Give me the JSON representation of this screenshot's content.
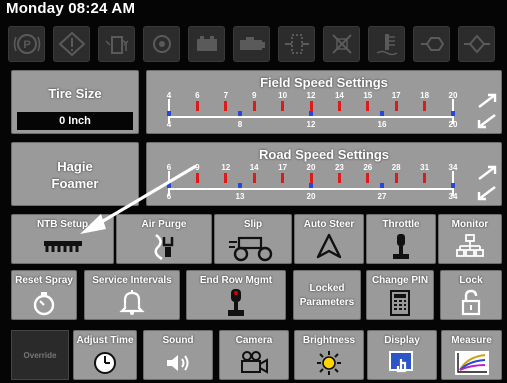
{
  "header": {
    "datetime": "Monday 08:24 AM"
  },
  "alarm_icons": [
    "parking-brake-icon",
    "warning-icon",
    "fuel-level-icon",
    "engine-icon",
    "battery-icon",
    "engine-oil-icon",
    "hydraulic-filter-icon",
    "fuel-filter-icon",
    "coolant-temp-icon",
    "transmission-icon",
    "hydraulic-oil-icon"
  ],
  "tire_size": {
    "label": "Tire Size",
    "value": "0 Inch"
  },
  "product": {
    "line1": "Hagie",
    "line2": "Foamer"
  },
  "field_speed": {
    "title": "Field Speed Settings",
    "top_labels": [
      "4",
      "6",
      "7",
      "9",
      "10",
      "12",
      "14",
      "15",
      "17",
      "18",
      "20"
    ],
    "bottom_labels": [
      "4",
      "8",
      "12",
      "16",
      "20"
    ]
  },
  "road_speed": {
    "title": "Road Speed Settings",
    "top_labels": [
      "6",
      "9",
      "12",
      "14",
      "17",
      "20",
      "23",
      "26",
      "28",
      "31",
      "34"
    ],
    "bottom_labels": [
      "6",
      "13",
      "20",
      "27",
      "34"
    ]
  },
  "buttons": {
    "ntb_setup": "NTB Setup",
    "air_purge": "Air Purge",
    "slip": "Slip",
    "auto_steer": "Auto Steer",
    "throttle": "Throttle",
    "monitor": "Monitor",
    "reset_spray": "Reset Spray",
    "service_intervals": "Service Intervals",
    "end_row_mgmt": "End Row Mgmt",
    "locked_line1": "Locked",
    "locked_line2": "Parameters",
    "change_pin": "Change PIN",
    "lock": "Lock",
    "override": "Override",
    "adjust_time": "Adjust Time",
    "sound": "Sound",
    "camera": "Camera",
    "brightness": "Brightness",
    "display": "Display",
    "measure": "Measure"
  },
  "colors": {
    "tile": "#9a9a9a",
    "background": "#050505",
    "tick_red": "#e01919",
    "tick_blue": "#2546e0",
    "callout_arrow": "#ffffff"
  }
}
